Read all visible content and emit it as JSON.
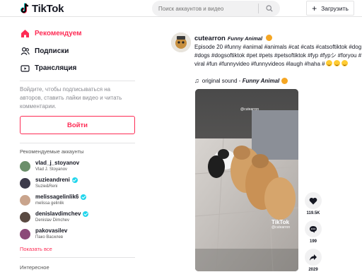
{
  "header": {
    "logo_text": "TikTok",
    "search_placeholder": "Поиск аккаунтов и видео",
    "upload_label": "Загрузить"
  },
  "sidebar": {
    "nav": [
      {
        "label": "Рекомендуем",
        "icon": "home-icon",
        "active": true
      },
      {
        "label": "Подписки",
        "icon": "following-icon",
        "active": false
      },
      {
        "label": "Трансляция",
        "icon": "live-icon",
        "active": false
      }
    ],
    "login_hint": "Войдите, чтобы подписываться на авторов, ставить лайки видео и читать комментарии.",
    "login_label": "Войти",
    "suggested_title": "Рекомендуемые аккаунты",
    "accounts": [
      {
        "username": "vlad_j_stoyanov",
        "name": "Vlad J. Stoyanov",
        "verified": false,
        "color": "#6b8f6a"
      },
      {
        "username": "suzieandreni",
        "name": "Suzie&Reni",
        "verified": true,
        "color": "#3c3a4a"
      },
      {
        "username": "melissagelinlik6",
        "name": "melissa gelinlik",
        "verified": true,
        "color": "#c9a48c"
      },
      {
        "username": "denislavdimchev",
        "name": "Denislav Dimchev",
        "verified": true,
        "color": "#5a4a42"
      },
      {
        "username": "pakovasilev",
        "name": "Пако Василев",
        "verified": false,
        "color": "#8c4a78"
      }
    ],
    "show_all": "Показать все",
    "interests_title": "Интересное"
  },
  "post": {
    "username": "cutearron",
    "nickname": "Funny Animal",
    "caption": "Episode 20 #funny #animal #animals #cat #cats #catsoftiktok #dog #dogs #dogsoftiktok #pet #pets #petsoftiktok #fyp #fypシ #foryou #viral #fun #funnyvideo #funnyvideos #laugh #haha #",
    "sound": "original sound - ",
    "sound_title": "Funny Animal",
    "watermark_user": "@cutearron",
    "watermark_logo": "TikTok",
    "actions": [
      {
        "icon": "heart-icon",
        "count": "119.5K"
      },
      {
        "icon": "comment-icon",
        "count": "199"
      },
      {
        "icon": "share-icon",
        "count": "2029"
      }
    ]
  },
  "colors": {
    "accent": "#fe2c55",
    "verified": "#20d5ec"
  }
}
